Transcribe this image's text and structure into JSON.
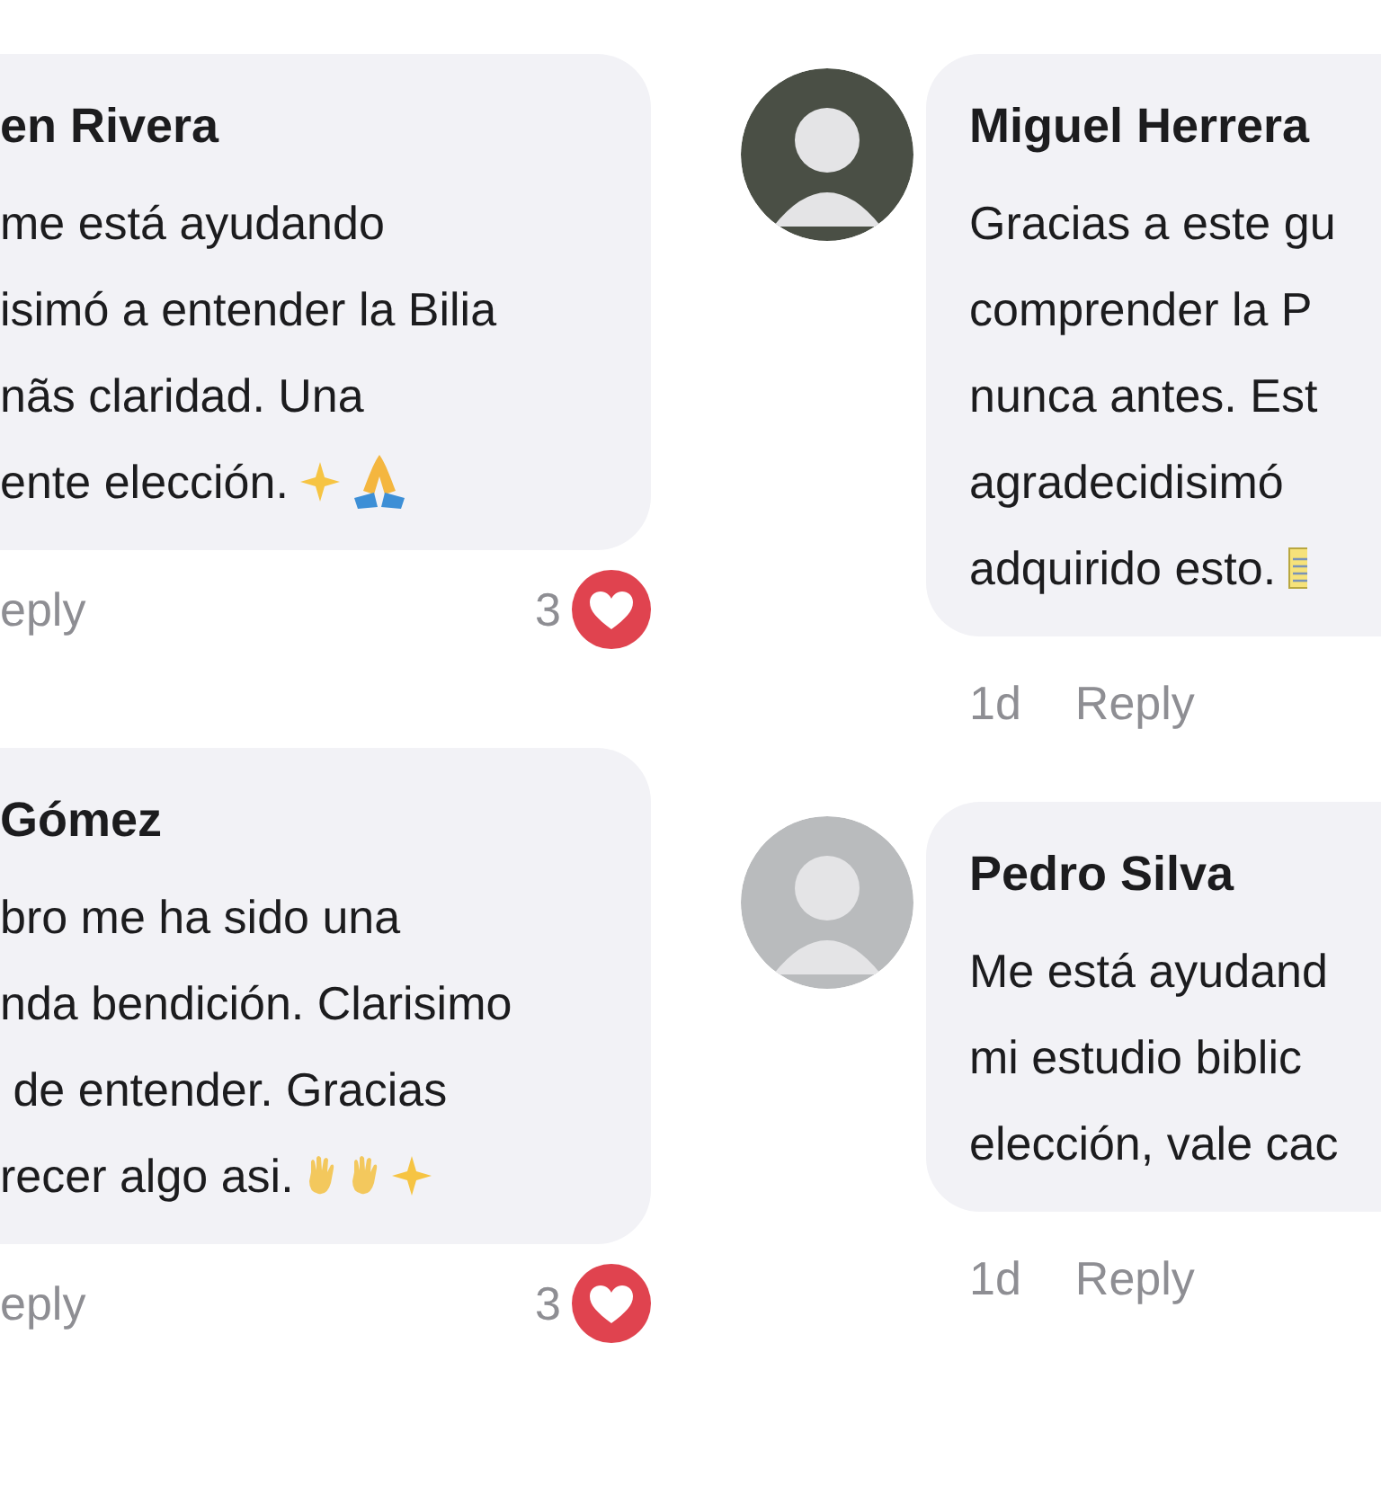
{
  "columns": [
    {
      "comments": [
        {
          "name": "en Rivera",
          "lines": [
            "me está ayudando",
            "isimó a entender la Bilia",
            "nãs claridad. Una",
            "ente elección."
          ],
          "emojis": [
            {
              "kind": "sparkles"
            },
            {
              "kind": "folded-hands"
            }
          ],
          "reply": "eply",
          "likes": "3"
        },
        {
          "name": " Gómez",
          "lines": [
            "bro me ha sido una",
            "nda bendición. Clarisimo",
            " de entender. Gracias",
            "recer algo asi."
          ],
          "emojis": [
            {
              "kind": "waving-hand"
            },
            {
              "kind": "waving-hand"
            },
            {
              "kind": "sparkles"
            }
          ],
          "reply": "eply",
          "likes": "3"
        }
      ]
    },
    {
      "comments": [
        {
          "avatar": {
            "color": "#4a4f45"
          },
          "name": "Miguel Herrera",
          "lines": [
            "Gracias a este gu",
            "comprender la P",
            "nunca antes. Est",
            "agradecidisimó",
            "adquirido esto."
          ],
          "emojis": [
            {
              "kind": "memo"
            }
          ],
          "time": "1d",
          "reply": "Reply"
        },
        {
          "avatar": {
            "color": "#b9bbbd"
          },
          "name": "Pedro Silva",
          "lines": [
            "Me está ayudand",
            "mi estudio biblic",
            "elección, vale cac"
          ],
          "time": "1d",
          "reply": "Reply"
        }
      ]
    }
  ]
}
